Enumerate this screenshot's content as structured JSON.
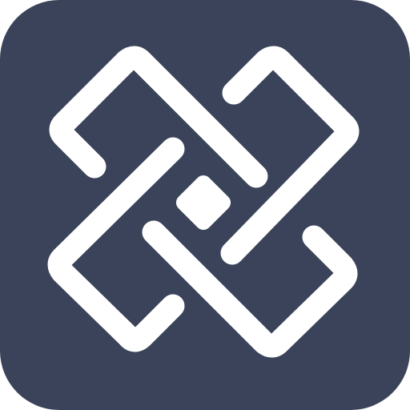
{
  "app_icon": {
    "icon_name": "interlocking-links-logo-icon",
    "background_color": "#3a4359",
    "foreground_color": "#ffffff"
  }
}
